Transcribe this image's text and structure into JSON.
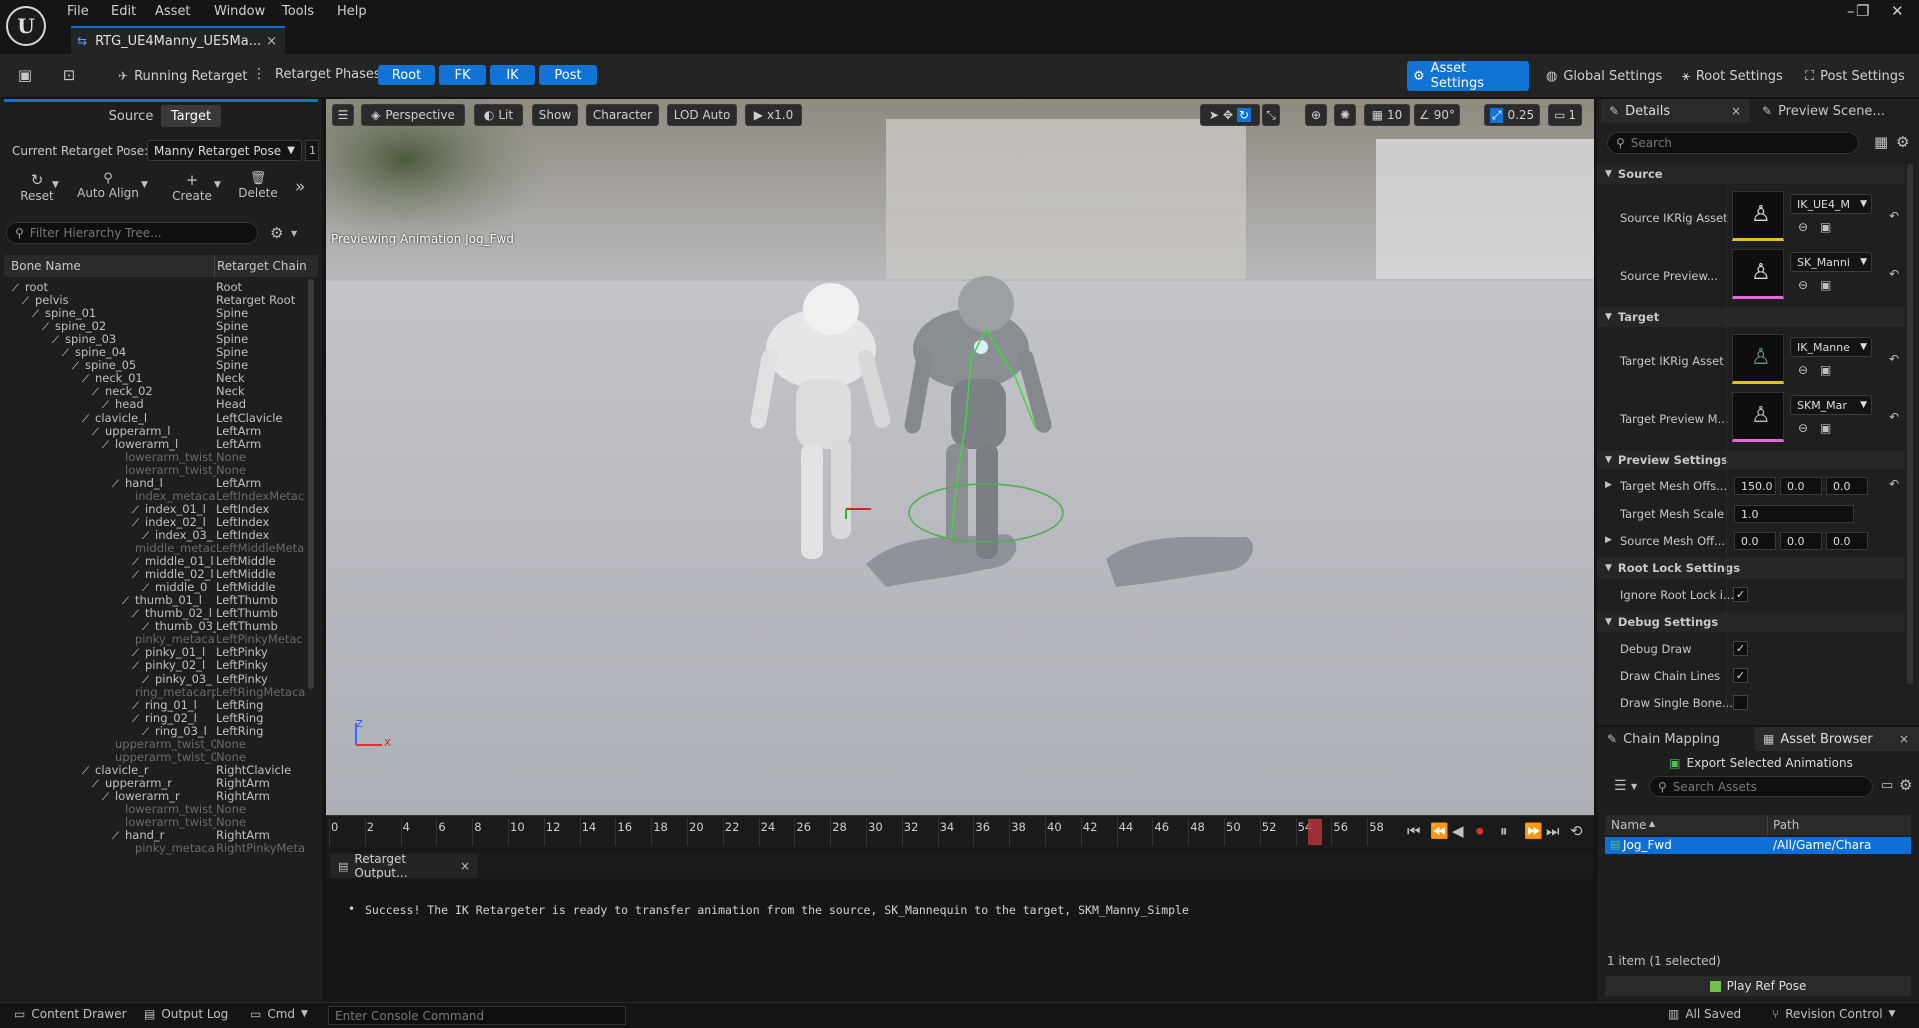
{
  "menu": {
    "logo": "U",
    "items": [
      "File",
      "Edit",
      "Asset",
      "Window",
      "Tools",
      "Help"
    ]
  },
  "window_controls": {
    "minimize": "–",
    "restore": "❐",
    "close": "✕"
  },
  "tab": {
    "title": "RTG_UE4Manny_UE5Ma...",
    "close": "×"
  },
  "toolbar": {
    "running_retarget": "Running Retarget",
    "phases_label": "Retarget Phases:",
    "phases": [
      "Root",
      "FK",
      "IK",
      "Post"
    ],
    "modes": [
      "Asset Settings",
      "Global Settings",
      "Root Settings",
      "Post Settings"
    ]
  },
  "left": {
    "tabs": [
      "Source",
      "Target"
    ],
    "pose_label": "Current Retarget Pose:",
    "pose_value": "Manny Retarget Pose",
    "pose_extra": "1",
    "actions": [
      "Reset",
      "Auto Align",
      "Create",
      "Delete"
    ],
    "filter_placeholder": "Filter Hierarchy Tree...",
    "col_bone": "Bone Name",
    "col_chain": "Retarget Chain",
    "rows": [
      {
        "bone": "root",
        "chain": "Root"
      },
      {
        "bone": "pelvis",
        "chain": "Retarget Root"
      },
      {
        "bone": "spine_01",
        "chain": "Spine"
      },
      {
        "bone": "spine_02",
        "chain": "Spine"
      },
      {
        "bone": "spine_03",
        "chain": "Spine"
      },
      {
        "bone": "spine_04",
        "chain": "Spine"
      },
      {
        "bone": "spine_05",
        "chain": "Spine"
      },
      {
        "bone": "neck_01",
        "chain": "Neck"
      },
      {
        "bone": "neck_02",
        "chain": "Neck"
      },
      {
        "bone": "head",
        "chain": "Head"
      },
      {
        "bone": "clavicle_l",
        "chain": "LeftClavicle"
      },
      {
        "bone": "upperarm_l",
        "chain": "LeftArm"
      },
      {
        "bone": "lowerarm_l",
        "chain": "LeftArm"
      },
      {
        "bone": "lowerarm_twist_",
        "chain": "None"
      },
      {
        "bone": "lowerarm_twist_",
        "chain": "None"
      },
      {
        "bone": "hand_l",
        "chain": "LeftArm"
      },
      {
        "bone": "index_metaca",
        "chain": "LeftIndexMetac"
      },
      {
        "bone": "index_01_l",
        "chain": "LeftIndex"
      },
      {
        "bone": "index_02_l",
        "chain": "LeftIndex"
      },
      {
        "bone": "index_03_",
        "chain": "LeftIndex"
      },
      {
        "bone": "middle_metac",
        "chain": "LeftMiddleMeta"
      },
      {
        "bone": "middle_01_l",
        "chain": "LeftMiddle"
      },
      {
        "bone": "middle_02_l",
        "chain": "LeftMiddle"
      },
      {
        "bone": "middle_0",
        "chain": "LeftMiddle"
      },
      {
        "bone": "thumb_01_l",
        "chain": "LeftThumb"
      },
      {
        "bone": "thumb_02_l",
        "chain": "LeftThumb"
      },
      {
        "bone": "thumb_03_",
        "chain": "LeftThumb"
      },
      {
        "bone": "pinky_metaca",
        "chain": "LeftPinkyMetac"
      },
      {
        "bone": "pinky_01_l",
        "chain": "LeftPinky"
      },
      {
        "bone": "pinky_02_l",
        "chain": "LeftPinky"
      },
      {
        "bone": "pinky_03_",
        "chain": "LeftPinky"
      },
      {
        "bone": "ring_metacarp",
        "chain": "LeftRingMetaca"
      },
      {
        "bone": "ring_01_l",
        "chain": "LeftRing"
      },
      {
        "bone": "ring_02_l",
        "chain": "LeftRing"
      },
      {
        "bone": "ring_03_l",
        "chain": "LeftRing"
      },
      {
        "bone": "upperarm_twist_0",
        "chain": "None"
      },
      {
        "bone": "upperarm_twist_0",
        "chain": "None"
      },
      {
        "bone": "clavicle_r",
        "chain": "RightClavicle"
      },
      {
        "bone": "upperarm_r",
        "chain": "RightArm"
      },
      {
        "bone": "lowerarm_r",
        "chain": "RightArm"
      },
      {
        "bone": "lowerarm_twist_",
        "chain": "None"
      },
      {
        "bone": "lowerarm_twist_",
        "chain": "None"
      },
      {
        "bone": "hand_r",
        "chain": "RightArm"
      },
      {
        "bone": "pinky_metaca",
        "chain": "RightPinkyMeta"
      }
    ]
  },
  "viewport": {
    "perspective": "Perspective",
    "lit": "Lit",
    "show": "Show",
    "character": "Character",
    "lod": "LOD Auto",
    "speed": "x1.0",
    "grid": "10",
    "angle": "90°",
    "scale": "0.25",
    "cam": "1",
    "preview_text": "Previewing Animation Jog_Fwd",
    "axis_z": "Z",
    "axis_x": "X"
  },
  "timeline": {
    "ticks": [
      "0",
      "2",
      "4",
      "6",
      "8",
      "10",
      "12",
      "14",
      "16",
      "18",
      "20",
      "22",
      "24",
      "26",
      "28",
      "30",
      "32",
      "34",
      "36",
      "38",
      "40",
      "42",
      "44",
      "46",
      "48",
      "50",
      "52",
      "54",
      "56",
      "58"
    ],
    "current_frame": 55
  },
  "output": {
    "tab": "Retarget Output...",
    "close": "×",
    "message": "Success! The IK Retargeter is ready to transfer animation from the source, SK_Mannequin to the target, SKM_Manny_Simple"
  },
  "details": {
    "tab1": "Details",
    "tab2": "Preview Scene...",
    "search_placeholder": "Search",
    "sec_source": "Source",
    "sec_target": "Target",
    "sec_preview": "Preview Settings",
    "sec_rootlock": "Root Lock Settings",
    "sec_debug": "Debug Settings",
    "source_ikrig_label": "Source IKRig Asset",
    "source_ikrig_value": "IK_UE4_M",
    "source_preview_label": "Source Preview...",
    "source_preview_value": "SK_Manni",
    "target_ikrig_label": "Target IKRig Asset",
    "target_ikrig_value": "IK_Manne",
    "target_preview_label": "Target Preview M...",
    "target_preview_value": "SKM_Mar",
    "target_mesh_offset_label": "Target Mesh Offs...",
    "target_mesh_offset": [
      "150.0",
      "0.0",
      "0.0"
    ],
    "target_mesh_scale_label": "Target Mesh Scale",
    "target_mesh_scale": "1.0",
    "source_mesh_offset_label": "Source Mesh Off...",
    "source_mesh_offset": [
      "0.0",
      "0.0",
      "0.0"
    ],
    "ignore_root_lock_label": "Ignore Root Lock i...",
    "debug_draw_label": "Debug Draw",
    "draw_chain_lines_label": "Draw Chain Lines",
    "draw_single_bone_label": "Draw Single Bone..."
  },
  "asset_browser": {
    "tab1": "Chain Mapping",
    "tab2": "Asset Browser",
    "close": "×",
    "export_btn": "Export Selected Animations",
    "search_placeholder": "Search Assets",
    "col_name": "Name",
    "col_path": "Path",
    "row_name": "Jog_Fwd",
    "row_path": "/All/Game/Chara",
    "count": "1 item (1 selected)",
    "play_ref": "Play Ref Pose"
  },
  "status": {
    "content_drawer": "Content Drawer",
    "output_log": "Output Log",
    "cmd": "Cmd",
    "console_placeholder": "Enter Console Command",
    "all_saved": "All Saved",
    "revision_control": "Revision Control"
  },
  "colors": {
    "accent": "#1173d4",
    "selection": "#0f6fd8"
  }
}
